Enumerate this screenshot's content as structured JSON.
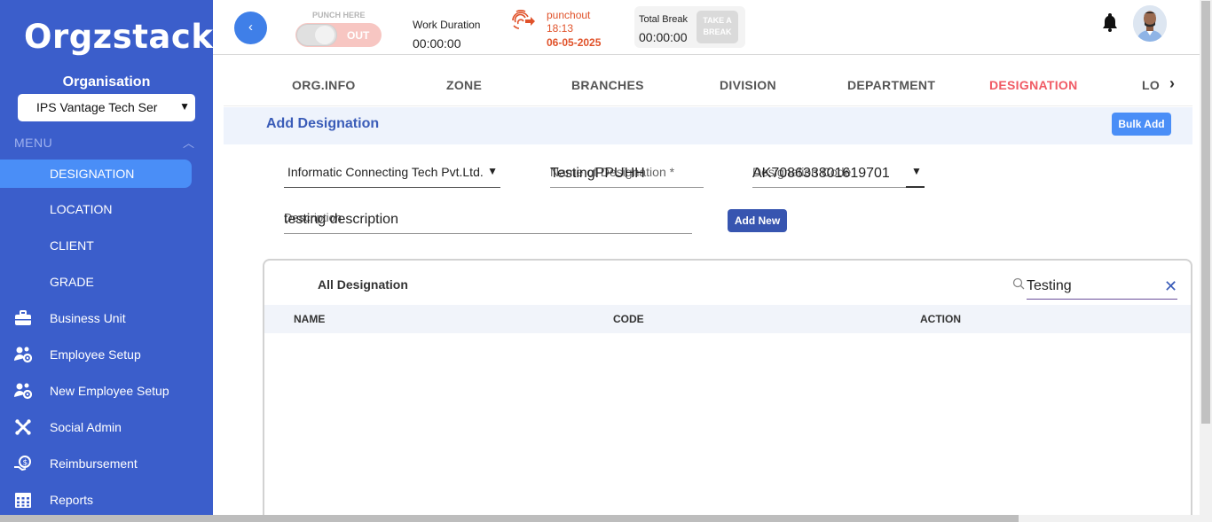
{
  "sidebar": {
    "logo": "Orgzstack",
    "org_label": "Organisation",
    "org_select": "IPS Vantage Tech Ser",
    "menu_label": "MENU",
    "sub_items": [
      {
        "label": "DESIGNATION",
        "active": true
      },
      {
        "label": "LOCATION",
        "active": false
      },
      {
        "label": "CLIENT",
        "active": false
      },
      {
        "label": "GRADE",
        "active": false
      }
    ],
    "main_items": [
      {
        "label": "Business Unit",
        "icon": "briefcase-icon"
      },
      {
        "label": "Employee Setup",
        "icon": "users-gear-icon"
      },
      {
        "label": "New Employee Setup",
        "icon": "users-gear-icon"
      },
      {
        "label": "Social Admin",
        "icon": "joomla-icon"
      },
      {
        "label": "Reimbursement",
        "icon": "money-hand-icon"
      },
      {
        "label": "Reports",
        "icon": "grid-calendar-icon"
      }
    ],
    "bg_color": "#3b5ecb",
    "active_color": "#4a8ef7"
  },
  "header": {
    "back_label": "‹",
    "punch_here_label": "PUNCH HERE",
    "punch_state": "OUT",
    "work_duration_label": "Work Duration",
    "work_duration_value": "00:00:00",
    "punch_status": "punchout",
    "punch_time": "18:13",
    "punch_date": "06-05-2025",
    "total_break_label": "Total Break",
    "total_break_value": "00:00:00",
    "take_break_label": "TAKE A BREAK"
  },
  "tabs": {
    "items": [
      {
        "label": "ORG.INFO",
        "active": false
      },
      {
        "label": "ZONE",
        "active": false
      },
      {
        "label": "BRANCHES",
        "active": false
      },
      {
        "label": "DIVISION",
        "active": false
      },
      {
        "label": "DEPARTMENT",
        "active": false
      },
      {
        "label": "DESIGNATION",
        "active": true
      },
      {
        "label": "LO",
        "active": false
      }
    ],
    "next_label": "›",
    "active_color": "#f05a64"
  },
  "section": {
    "title": "Add Designation",
    "bulk_add_label": "Bulk Add"
  },
  "form": {
    "company_value": "Informatic Connecting Tech Pvt.Ltd.",
    "name_placeholder": "Name of Designation  *",
    "name_value": "TestingPPUHH",
    "code_placeholder": "Designation Code",
    "code_value": "AK708633801619701",
    "description_placeholder": "Description",
    "description_value": "testing description",
    "add_new_label": "Add New"
  },
  "table": {
    "title": "All Designation",
    "search_value": "Testing",
    "columns": [
      "NAME",
      "CODE",
      "ACTION"
    ],
    "rows": []
  }
}
